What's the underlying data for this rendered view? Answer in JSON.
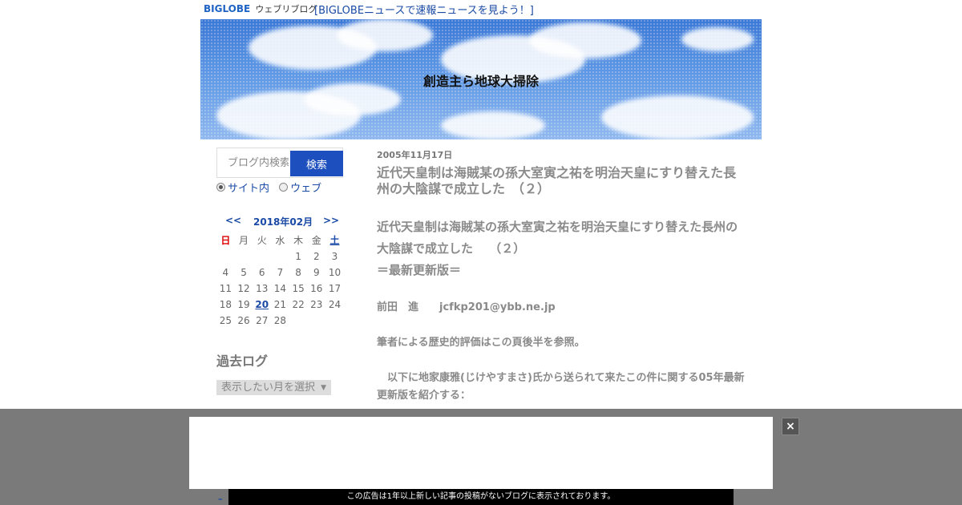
{
  "header": {
    "logo_text": "BIGLOBE",
    "logo_sub": "ウェブリブログ",
    "news_link": "[BIGLOBEニュースで速報ニュースを見よう！]"
  },
  "banner": {
    "blog_title": "創造主ら地球大掃除"
  },
  "sidebar": {
    "search_placeholder": "ブログ内検索",
    "search_button": "検索",
    "radio_site": "サイト内",
    "radio_web": "ウェブ",
    "calendar": {
      "prev": "<<",
      "month": "2018年02月",
      "next": ">>",
      "weekdays": [
        "日",
        "月",
        "火",
        "水",
        "木",
        "金",
        "土"
      ],
      "weeks": [
        [
          "",
          "",
          "",
          "",
          "1",
          "2",
          "3"
        ],
        [
          "4",
          "5",
          "6",
          "7",
          "8",
          "9",
          "10"
        ],
        [
          "11",
          "12",
          "13",
          "14",
          "15",
          "16",
          "17"
        ],
        [
          "18",
          "19",
          "20",
          "21",
          "22",
          "23",
          "24"
        ],
        [
          "25",
          "26",
          "27",
          "28",
          "",
          "",
          ""
        ]
      ],
      "today": "20"
    },
    "archive_title": "過去ログ",
    "archive_select": "表示したい月を選択"
  },
  "post": {
    "date": "2005年11月17日",
    "title": "近代天皇制は海賊某の孫大室寅之祐を明治天皇にすり替えた長州の大陰謀で成立した　（２）",
    "body_heading_1": "近代天皇制は海賊某の孫大室寅之祐を明治天皇にすり替えた長州の大陰謀で成立した　 （２）",
    "body_heading_2": "＝最新更新版＝",
    "author": "前田　進　　jcfkp201@ybb.ne.jp",
    "note": "筆者による歴史的評価はこの頁後半を参照。",
    "intro": "　以下に地家康雅(じけやすまさ)氏から送られて来たこの件に関する05年最新更新版を紹介する："
  },
  "ad": {
    "close_label": "×",
    "notice": "この広告は1年以上新しい記事の投稿がないブログに表示されております。"
  },
  "colors": {
    "link": "#1a4aa5",
    "search_button": "#1d4fbe",
    "sunday": "#dd0000",
    "overlay": "#7a7a7a"
  }
}
